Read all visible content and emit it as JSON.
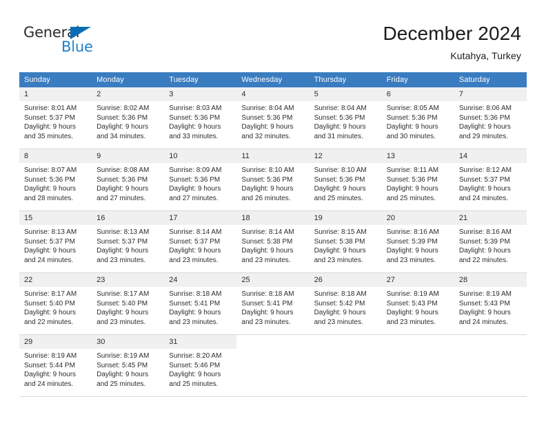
{
  "brand": {
    "name_part1": "General",
    "name_part2": "Blue",
    "triangle_color": "#0a6cb4",
    "blue_color": "#1e80c8"
  },
  "header": {
    "title": "December 2024",
    "subtitle": "Kutahya, Turkey"
  },
  "theme": {
    "header_row_bg": "#3a7cc0",
    "daynum_bg": "#f0f0f0",
    "border_color": "#d8d8d8",
    "text_color": "#2c2c2c"
  },
  "weekdays": [
    "Sunday",
    "Monday",
    "Tuesday",
    "Wednesday",
    "Thursday",
    "Friday",
    "Saturday"
  ],
  "weeks": [
    [
      {
        "day": "1",
        "sunrise": "Sunrise: 8:01 AM",
        "sunset": "Sunset: 5:37 PM",
        "daylight1": "Daylight: 9 hours",
        "daylight2": "and 35 minutes."
      },
      {
        "day": "2",
        "sunrise": "Sunrise: 8:02 AM",
        "sunset": "Sunset: 5:36 PM",
        "daylight1": "Daylight: 9 hours",
        "daylight2": "and 34 minutes."
      },
      {
        "day": "3",
        "sunrise": "Sunrise: 8:03 AM",
        "sunset": "Sunset: 5:36 PM",
        "daylight1": "Daylight: 9 hours",
        "daylight2": "and 33 minutes."
      },
      {
        "day": "4",
        "sunrise": "Sunrise: 8:04 AM",
        "sunset": "Sunset: 5:36 PM",
        "daylight1": "Daylight: 9 hours",
        "daylight2": "and 32 minutes."
      },
      {
        "day": "5",
        "sunrise": "Sunrise: 8:04 AM",
        "sunset": "Sunset: 5:36 PM",
        "daylight1": "Daylight: 9 hours",
        "daylight2": "and 31 minutes."
      },
      {
        "day": "6",
        "sunrise": "Sunrise: 8:05 AM",
        "sunset": "Sunset: 5:36 PM",
        "daylight1": "Daylight: 9 hours",
        "daylight2": "and 30 minutes."
      },
      {
        "day": "7",
        "sunrise": "Sunrise: 8:06 AM",
        "sunset": "Sunset: 5:36 PM",
        "daylight1": "Daylight: 9 hours",
        "daylight2": "and 29 minutes."
      }
    ],
    [
      {
        "day": "8",
        "sunrise": "Sunrise: 8:07 AM",
        "sunset": "Sunset: 5:36 PM",
        "daylight1": "Daylight: 9 hours",
        "daylight2": "and 28 minutes."
      },
      {
        "day": "9",
        "sunrise": "Sunrise: 8:08 AM",
        "sunset": "Sunset: 5:36 PM",
        "daylight1": "Daylight: 9 hours",
        "daylight2": "and 27 minutes."
      },
      {
        "day": "10",
        "sunrise": "Sunrise: 8:09 AM",
        "sunset": "Sunset: 5:36 PM",
        "daylight1": "Daylight: 9 hours",
        "daylight2": "and 27 minutes."
      },
      {
        "day": "11",
        "sunrise": "Sunrise: 8:10 AM",
        "sunset": "Sunset: 5:36 PM",
        "daylight1": "Daylight: 9 hours",
        "daylight2": "and 26 minutes."
      },
      {
        "day": "12",
        "sunrise": "Sunrise: 8:10 AM",
        "sunset": "Sunset: 5:36 PM",
        "daylight1": "Daylight: 9 hours",
        "daylight2": "and 25 minutes."
      },
      {
        "day": "13",
        "sunrise": "Sunrise: 8:11 AM",
        "sunset": "Sunset: 5:36 PM",
        "daylight1": "Daylight: 9 hours",
        "daylight2": "and 25 minutes."
      },
      {
        "day": "14",
        "sunrise": "Sunrise: 8:12 AM",
        "sunset": "Sunset: 5:37 PM",
        "daylight1": "Daylight: 9 hours",
        "daylight2": "and 24 minutes."
      }
    ],
    [
      {
        "day": "15",
        "sunrise": "Sunrise: 8:13 AM",
        "sunset": "Sunset: 5:37 PM",
        "daylight1": "Daylight: 9 hours",
        "daylight2": "and 24 minutes."
      },
      {
        "day": "16",
        "sunrise": "Sunrise: 8:13 AM",
        "sunset": "Sunset: 5:37 PM",
        "daylight1": "Daylight: 9 hours",
        "daylight2": "and 23 minutes."
      },
      {
        "day": "17",
        "sunrise": "Sunrise: 8:14 AM",
        "sunset": "Sunset: 5:37 PM",
        "daylight1": "Daylight: 9 hours",
        "daylight2": "and 23 minutes."
      },
      {
        "day": "18",
        "sunrise": "Sunrise: 8:14 AM",
        "sunset": "Sunset: 5:38 PM",
        "daylight1": "Daylight: 9 hours",
        "daylight2": "and 23 minutes."
      },
      {
        "day": "19",
        "sunrise": "Sunrise: 8:15 AM",
        "sunset": "Sunset: 5:38 PM",
        "daylight1": "Daylight: 9 hours",
        "daylight2": "and 23 minutes."
      },
      {
        "day": "20",
        "sunrise": "Sunrise: 8:16 AM",
        "sunset": "Sunset: 5:39 PM",
        "daylight1": "Daylight: 9 hours",
        "daylight2": "and 23 minutes."
      },
      {
        "day": "21",
        "sunrise": "Sunrise: 8:16 AM",
        "sunset": "Sunset: 5:39 PM",
        "daylight1": "Daylight: 9 hours",
        "daylight2": "and 22 minutes."
      }
    ],
    [
      {
        "day": "22",
        "sunrise": "Sunrise: 8:17 AM",
        "sunset": "Sunset: 5:40 PM",
        "daylight1": "Daylight: 9 hours",
        "daylight2": "and 22 minutes."
      },
      {
        "day": "23",
        "sunrise": "Sunrise: 8:17 AM",
        "sunset": "Sunset: 5:40 PM",
        "daylight1": "Daylight: 9 hours",
        "daylight2": "and 23 minutes."
      },
      {
        "day": "24",
        "sunrise": "Sunrise: 8:18 AM",
        "sunset": "Sunset: 5:41 PM",
        "daylight1": "Daylight: 9 hours",
        "daylight2": "and 23 minutes."
      },
      {
        "day": "25",
        "sunrise": "Sunrise: 8:18 AM",
        "sunset": "Sunset: 5:41 PM",
        "daylight1": "Daylight: 9 hours",
        "daylight2": "and 23 minutes."
      },
      {
        "day": "26",
        "sunrise": "Sunrise: 8:18 AM",
        "sunset": "Sunset: 5:42 PM",
        "daylight1": "Daylight: 9 hours",
        "daylight2": "and 23 minutes."
      },
      {
        "day": "27",
        "sunrise": "Sunrise: 8:19 AM",
        "sunset": "Sunset: 5:43 PM",
        "daylight1": "Daylight: 9 hours",
        "daylight2": "and 23 minutes."
      },
      {
        "day": "28",
        "sunrise": "Sunrise: 8:19 AM",
        "sunset": "Sunset: 5:43 PM",
        "daylight1": "Daylight: 9 hours",
        "daylight2": "and 24 minutes."
      }
    ],
    [
      {
        "day": "29",
        "sunrise": "Sunrise: 8:19 AM",
        "sunset": "Sunset: 5:44 PM",
        "daylight1": "Daylight: 9 hours",
        "daylight2": "and 24 minutes."
      },
      {
        "day": "30",
        "sunrise": "Sunrise: 8:19 AM",
        "sunset": "Sunset: 5:45 PM",
        "daylight1": "Daylight: 9 hours",
        "daylight2": "and 25 minutes."
      },
      {
        "day": "31",
        "sunrise": "Sunrise: 8:20 AM",
        "sunset": "Sunset: 5:46 PM",
        "daylight1": "Daylight: 9 hours",
        "daylight2": "and 25 minutes."
      },
      {
        "day": "",
        "sunrise": "",
        "sunset": "",
        "daylight1": "",
        "daylight2": ""
      },
      {
        "day": "",
        "sunrise": "",
        "sunset": "",
        "daylight1": "",
        "daylight2": ""
      },
      {
        "day": "",
        "sunrise": "",
        "sunset": "",
        "daylight1": "",
        "daylight2": ""
      },
      {
        "day": "",
        "sunrise": "",
        "sunset": "",
        "daylight1": "",
        "daylight2": ""
      }
    ]
  ]
}
